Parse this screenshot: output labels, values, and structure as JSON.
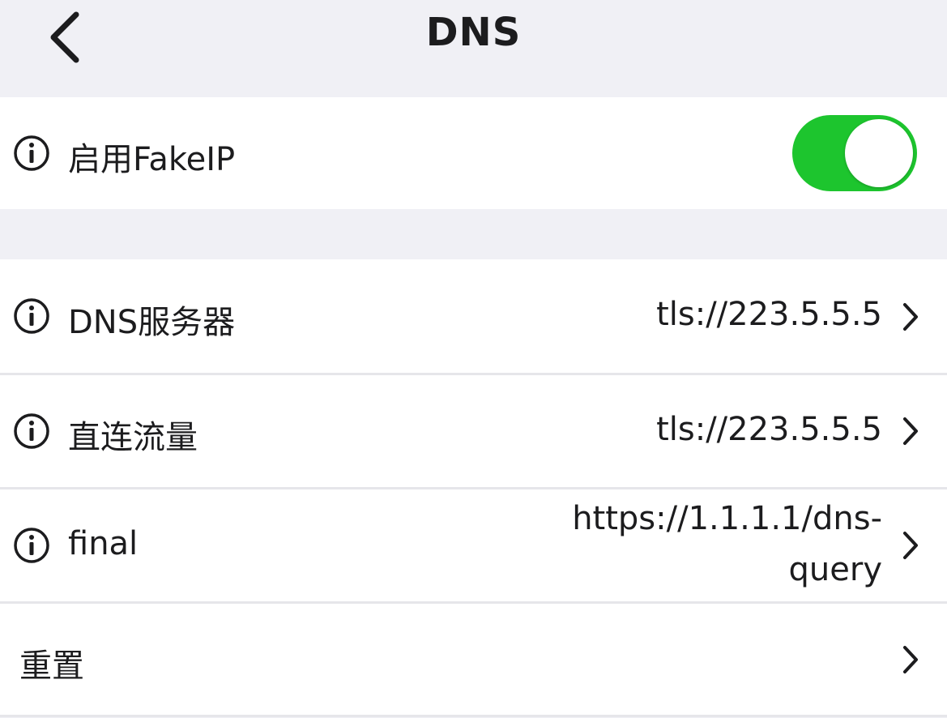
{
  "nav": {
    "title": "DNS",
    "back_icon": "chevron-left-icon"
  },
  "fakeip": {
    "label": "启用FakeIP",
    "enabled": true,
    "toggle_color": "#1dc52e"
  },
  "dns_settings": {
    "items": [
      {
        "label": "DNS服务器",
        "value": "tls://223.5.5.5"
      },
      {
        "label": "直连流量",
        "value": "tls://223.5.5.5"
      },
      {
        "label": "final",
        "value_line1": "https://1.1.1.1/dns-",
        "value_line2": "query"
      }
    ]
  },
  "reset": {
    "label": "重置"
  }
}
